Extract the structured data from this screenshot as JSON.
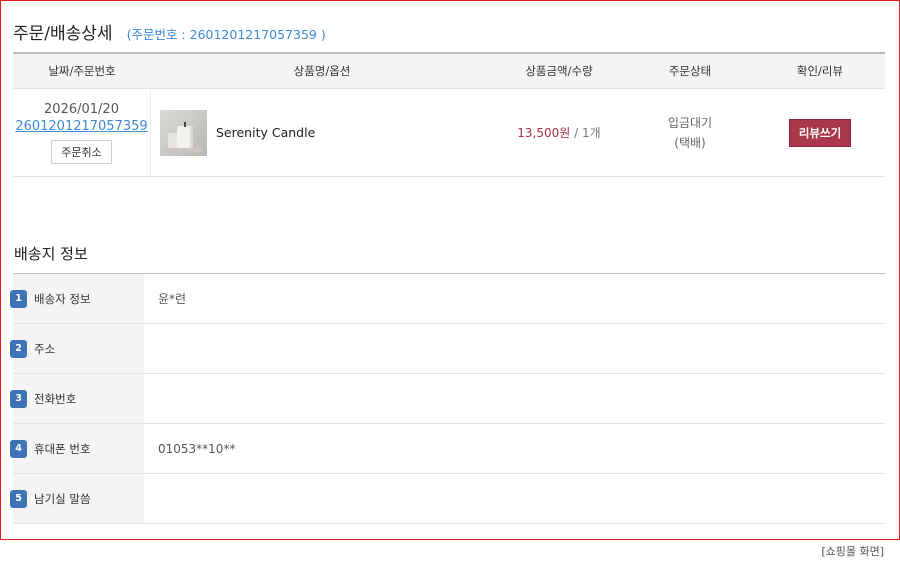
{
  "header": {
    "title": "주문/배송상세",
    "order_number_text": "(주문번호 : 2601201217057359 )"
  },
  "order_table": {
    "columns": [
      "날짜/주문번호",
      "상품명/옵션",
      "상품금액/수량",
      "주문상태",
      "확인/리뷰"
    ],
    "row": {
      "date": "2026/01/20",
      "order_number": "2601201217057359",
      "cancel_label": "주문취소",
      "product_name": "Serenity Candle",
      "price": "13,500원",
      "separator": "/",
      "quantity": "1개",
      "status_line1": "입금대기",
      "status_line2": "(택배)",
      "review_label": "리뷰쓰기",
      "thumbnail_icon": "candle-product-image"
    }
  },
  "shipping": {
    "title": "배송지 정보",
    "rows": [
      {
        "num": "1",
        "label": "배송자 정보",
        "value": "윤*련"
      },
      {
        "num": "2",
        "label": "주소",
        "value": ""
      },
      {
        "num": "3",
        "label": "전화번호",
        "value": ""
      },
      {
        "num": "4",
        "label": "휴대폰 번호",
        "value": "01053**10**"
      },
      {
        "num": "5",
        "label": "남기실 말씀",
        "value": ""
      }
    ]
  },
  "caption": "[쇼핑몰 화면]",
  "colors": {
    "accent_blue": "#3d8ad6",
    "price_red": "#a23345",
    "review_button": "#a8384a",
    "badge_blue": "#3f73b8",
    "frame_border": "#e01a1a"
  }
}
